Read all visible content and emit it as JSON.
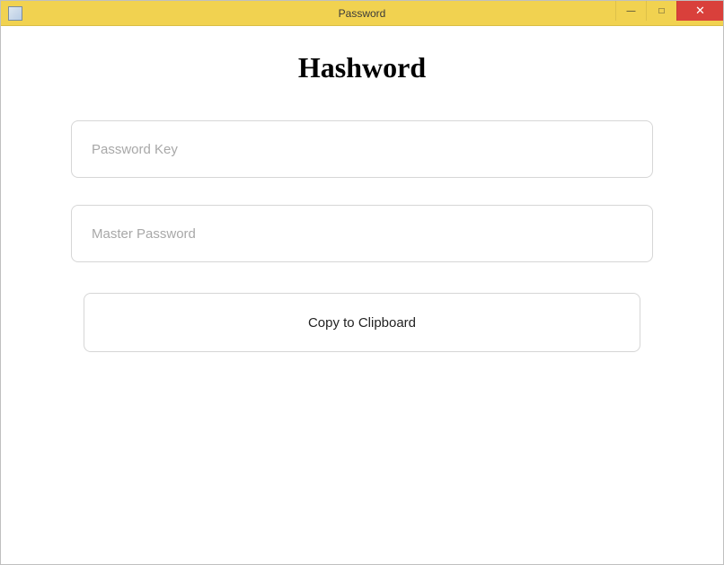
{
  "window": {
    "title": "Password",
    "minimize_symbol": "—",
    "maximize_symbol": "□",
    "close_symbol": "✕"
  },
  "app": {
    "title": "Hashword"
  },
  "form": {
    "password_key": {
      "placeholder": "Password Key",
      "value": ""
    },
    "master_password": {
      "placeholder": "Master Password",
      "value": ""
    },
    "copy_button_label": "Copy to Clipboard"
  }
}
